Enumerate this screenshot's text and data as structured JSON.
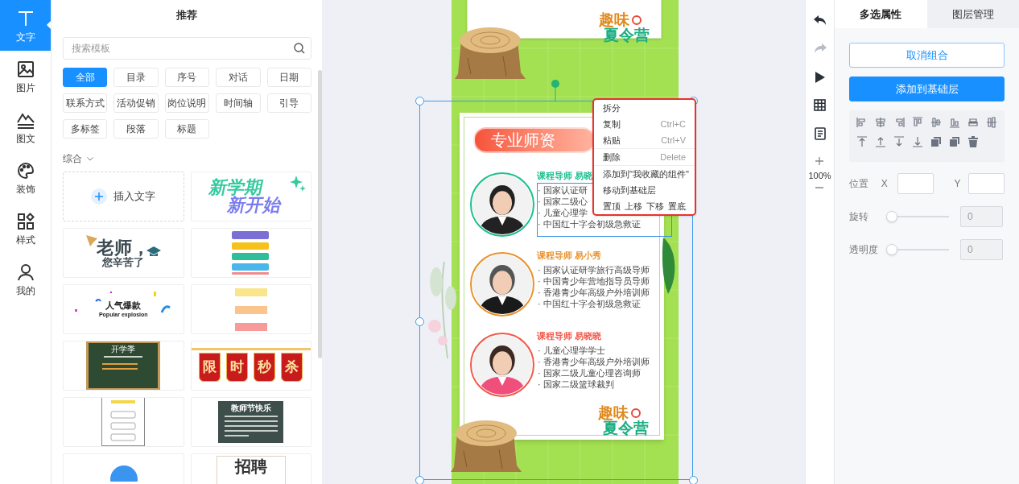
{
  "sidebar": {
    "items": [
      {
        "label": "文字",
        "selected": true
      },
      {
        "label": "图片",
        "selected": false
      },
      {
        "label": "图文",
        "selected": false
      },
      {
        "label": "装饰",
        "selected": false
      },
      {
        "label": "样式",
        "selected": false
      },
      {
        "label": "我的",
        "selected": false
      }
    ]
  },
  "panel": {
    "title": "推荐",
    "search": {
      "placeholder": "搜索模板"
    },
    "tags": [
      {
        "label": "全部",
        "selected": true
      },
      {
        "label": "目录",
        "selected": false
      },
      {
        "label": "序号",
        "selected": false
      },
      {
        "label": "对话",
        "selected": false
      },
      {
        "label": "日期",
        "selected": false
      },
      {
        "label": "联系方式",
        "selected": false
      },
      {
        "label": "活动促销",
        "selected": false
      },
      {
        "label": "岗位说明",
        "selected": false
      },
      {
        "label": "时间轴",
        "selected": false
      },
      {
        "label": "引导",
        "selected": false
      },
      {
        "label": "多标签",
        "selected": false
      },
      {
        "label": "段落",
        "selected": false
      },
      {
        "label": "标题",
        "selected": false
      }
    ],
    "filter": {
      "label": "综合"
    },
    "templates": [
      {
        "kind": "insert",
        "texts": [
          "插入文字"
        ]
      },
      {
        "kind": "slogan",
        "texts": [
          "新学期",
          "新开始"
        ]
      },
      {
        "kind": "thanks",
        "texts": [
          "老师，",
          "您辛苦了"
        ]
      },
      {
        "kind": "steps"
      },
      {
        "kind": "popular",
        "texts": [
          "人气爆款",
          "Popular explosion"
        ]
      },
      {
        "kind": "ribbons"
      },
      {
        "kind": "blackboard",
        "texts": [
          "开学季"
        ]
      },
      {
        "kind": "flags",
        "texts": [
          "限",
          "时",
          "秒",
          "杀"
        ]
      },
      {
        "kind": "list"
      },
      {
        "kind": "card",
        "texts": [
          "教师节快乐"
        ]
      },
      {
        "kind": "badge"
      },
      {
        "kind": "recruit",
        "texts": [
          "招聘"
        ]
      }
    ]
  },
  "canvas": {
    "logos": [
      {
        "texts": [
          "趣味",
          "夏令营"
        ]
      },
      {
        "texts": [
          "趣味",
          "夏令营"
        ]
      }
    ],
    "section_title": "专业师资",
    "teachers": [
      {
        "name": "课程导师 易晓",
        "color": "#1cbf8f",
        "lines": [
          "· 国家认证研",
          "· 国家二级心",
          "· 儿童心理学",
          "· 中国红十字会初级急救证"
        ]
      },
      {
        "name": "课程导师 易小秀",
        "color": "#e8922e",
        "lines": [
          "· 国家认证研学旅行高级导师",
          "· 中国青少年营地指导员导师",
          "· 香港青少年高级户外培训师",
          "· 中国红十字会初级急救证"
        ]
      },
      {
        "name": "课程导师 易晓晓",
        "color": "#f0584a",
        "lines": [
          "· 儿童心理学学士",
          "· 香港青少年高级户外培训师",
          "· 国家二级儿童心理咨询师",
          "· 国家二级篮球裁判"
        ]
      }
    ],
    "context_menu": {
      "items": [
        {
          "kind": "item",
          "label": "拆分"
        },
        {
          "kind": "item",
          "label": "复制",
          "shortcut": "Ctrl+C"
        },
        {
          "kind": "item",
          "label": "粘贴",
          "shortcut": "Ctrl+V"
        },
        {
          "kind": "divider"
        },
        {
          "kind": "item",
          "label": "删除",
          "shortcut": "Delete"
        },
        {
          "kind": "divider"
        },
        {
          "kind": "item",
          "label": "添加到\"我收藏的组件\""
        },
        {
          "kind": "item",
          "label": "移动到基础层"
        },
        {
          "kind": "order",
          "options": [
            "置顶",
            "上移",
            "下移",
            "置底"
          ]
        }
      ]
    }
  },
  "toolbar": {
    "tools": [
      {
        "kind": "undo",
        "disabled": false
      },
      {
        "kind": "redo",
        "disabled": true
      },
      {
        "kind": "play",
        "disabled": false
      },
      {
        "kind": "grid",
        "disabled": false
      },
      {
        "kind": "notes",
        "disabled": false
      }
    ],
    "zoom": "100%"
  },
  "properties": {
    "tabs": [
      {
        "label": "多选属性",
        "selected": true
      },
      {
        "label": "图层管理",
        "selected": false
      }
    ],
    "buttons": [
      {
        "kind": "outline",
        "label": "取消组合"
      },
      {
        "kind": "primary",
        "label": "添加到基础层"
      }
    ],
    "position": {
      "label": "位置",
      "x_label": "X",
      "y_label": "Y"
    },
    "sliders": [
      {
        "label": "旋转",
        "level": 0,
        "value": "0"
      },
      {
        "label": "透明度",
        "level": 0,
        "value": "0"
      }
    ]
  }
}
